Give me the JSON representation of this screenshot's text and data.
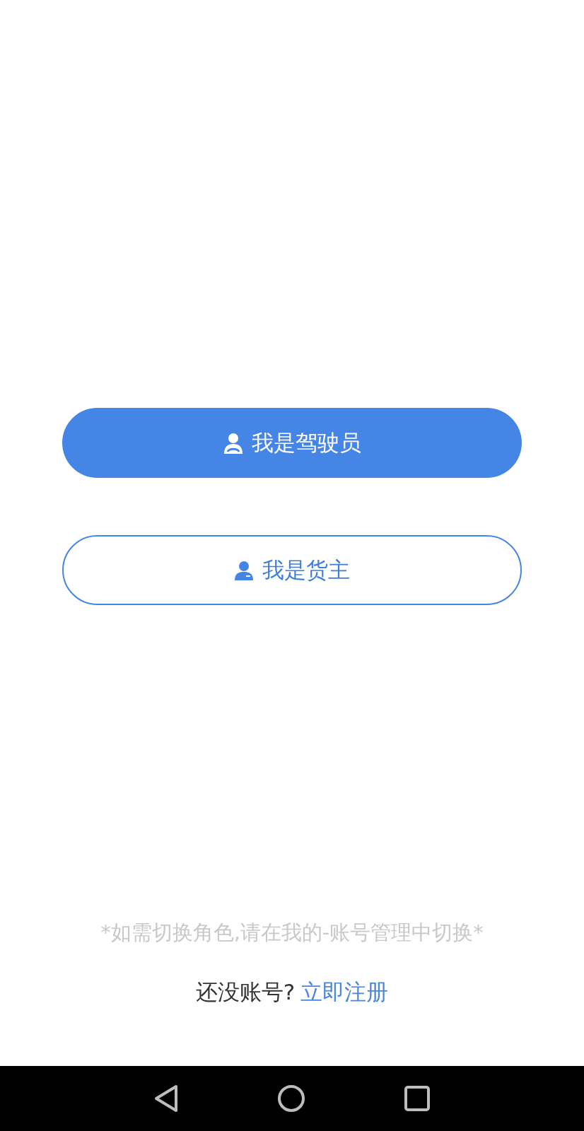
{
  "role_buttons": [
    {
      "label": "我是驾驶员",
      "selected": true
    },
    {
      "label": "我是货主",
      "selected": false
    }
  ],
  "hint": "*如需切换角色,请在我的-账号管理中切换*",
  "register": {
    "prompt": "还没账号?",
    "link": "立即注册"
  }
}
